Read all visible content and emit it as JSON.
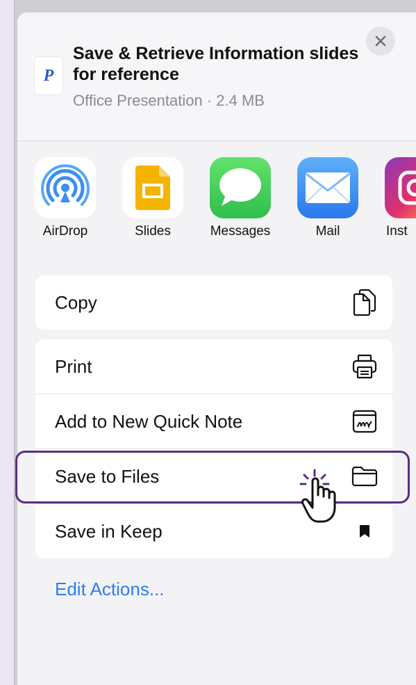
{
  "share_sheet": {
    "document": {
      "icon_letter": "P",
      "title": "Save & Retrieve Information slides for reference",
      "subtitle": "Office Presentation · 2.4 MB"
    },
    "close_icon": "close-icon"
  },
  "apps": [
    {
      "label": "AirDrop",
      "icon": "airdrop-icon",
      "color": "#3b8ef5"
    },
    {
      "label": "Slides",
      "icon": "google-slides-icon",
      "color": "#f4b400"
    },
    {
      "label": "Messages",
      "icon": "messages-icon",
      "color": "#3ecb5b"
    },
    {
      "label": "Mail",
      "icon": "mail-icon",
      "color": "#3a8bf1"
    },
    {
      "label": "Inst",
      "icon": "instagram-icon",
      "color": "#c13584"
    }
  ],
  "actions_group_1": [
    {
      "label": "Copy",
      "icon": "copy-icon"
    }
  ],
  "actions_group_2": [
    {
      "label": "Print",
      "icon": "printer-icon"
    },
    {
      "label": "Add to New Quick Note",
      "icon": "quick-note-icon"
    },
    {
      "label": "Save to Files",
      "icon": "folder-icon"
    },
    {
      "label": "Save in Keep",
      "icon": "bookmark-icon"
    }
  ],
  "edit_actions_label": "Edit Actions...",
  "highlight": {
    "target": "Save to Files",
    "color": "#5a2c82",
    "pointer_icon": "tap-hand-icon"
  }
}
